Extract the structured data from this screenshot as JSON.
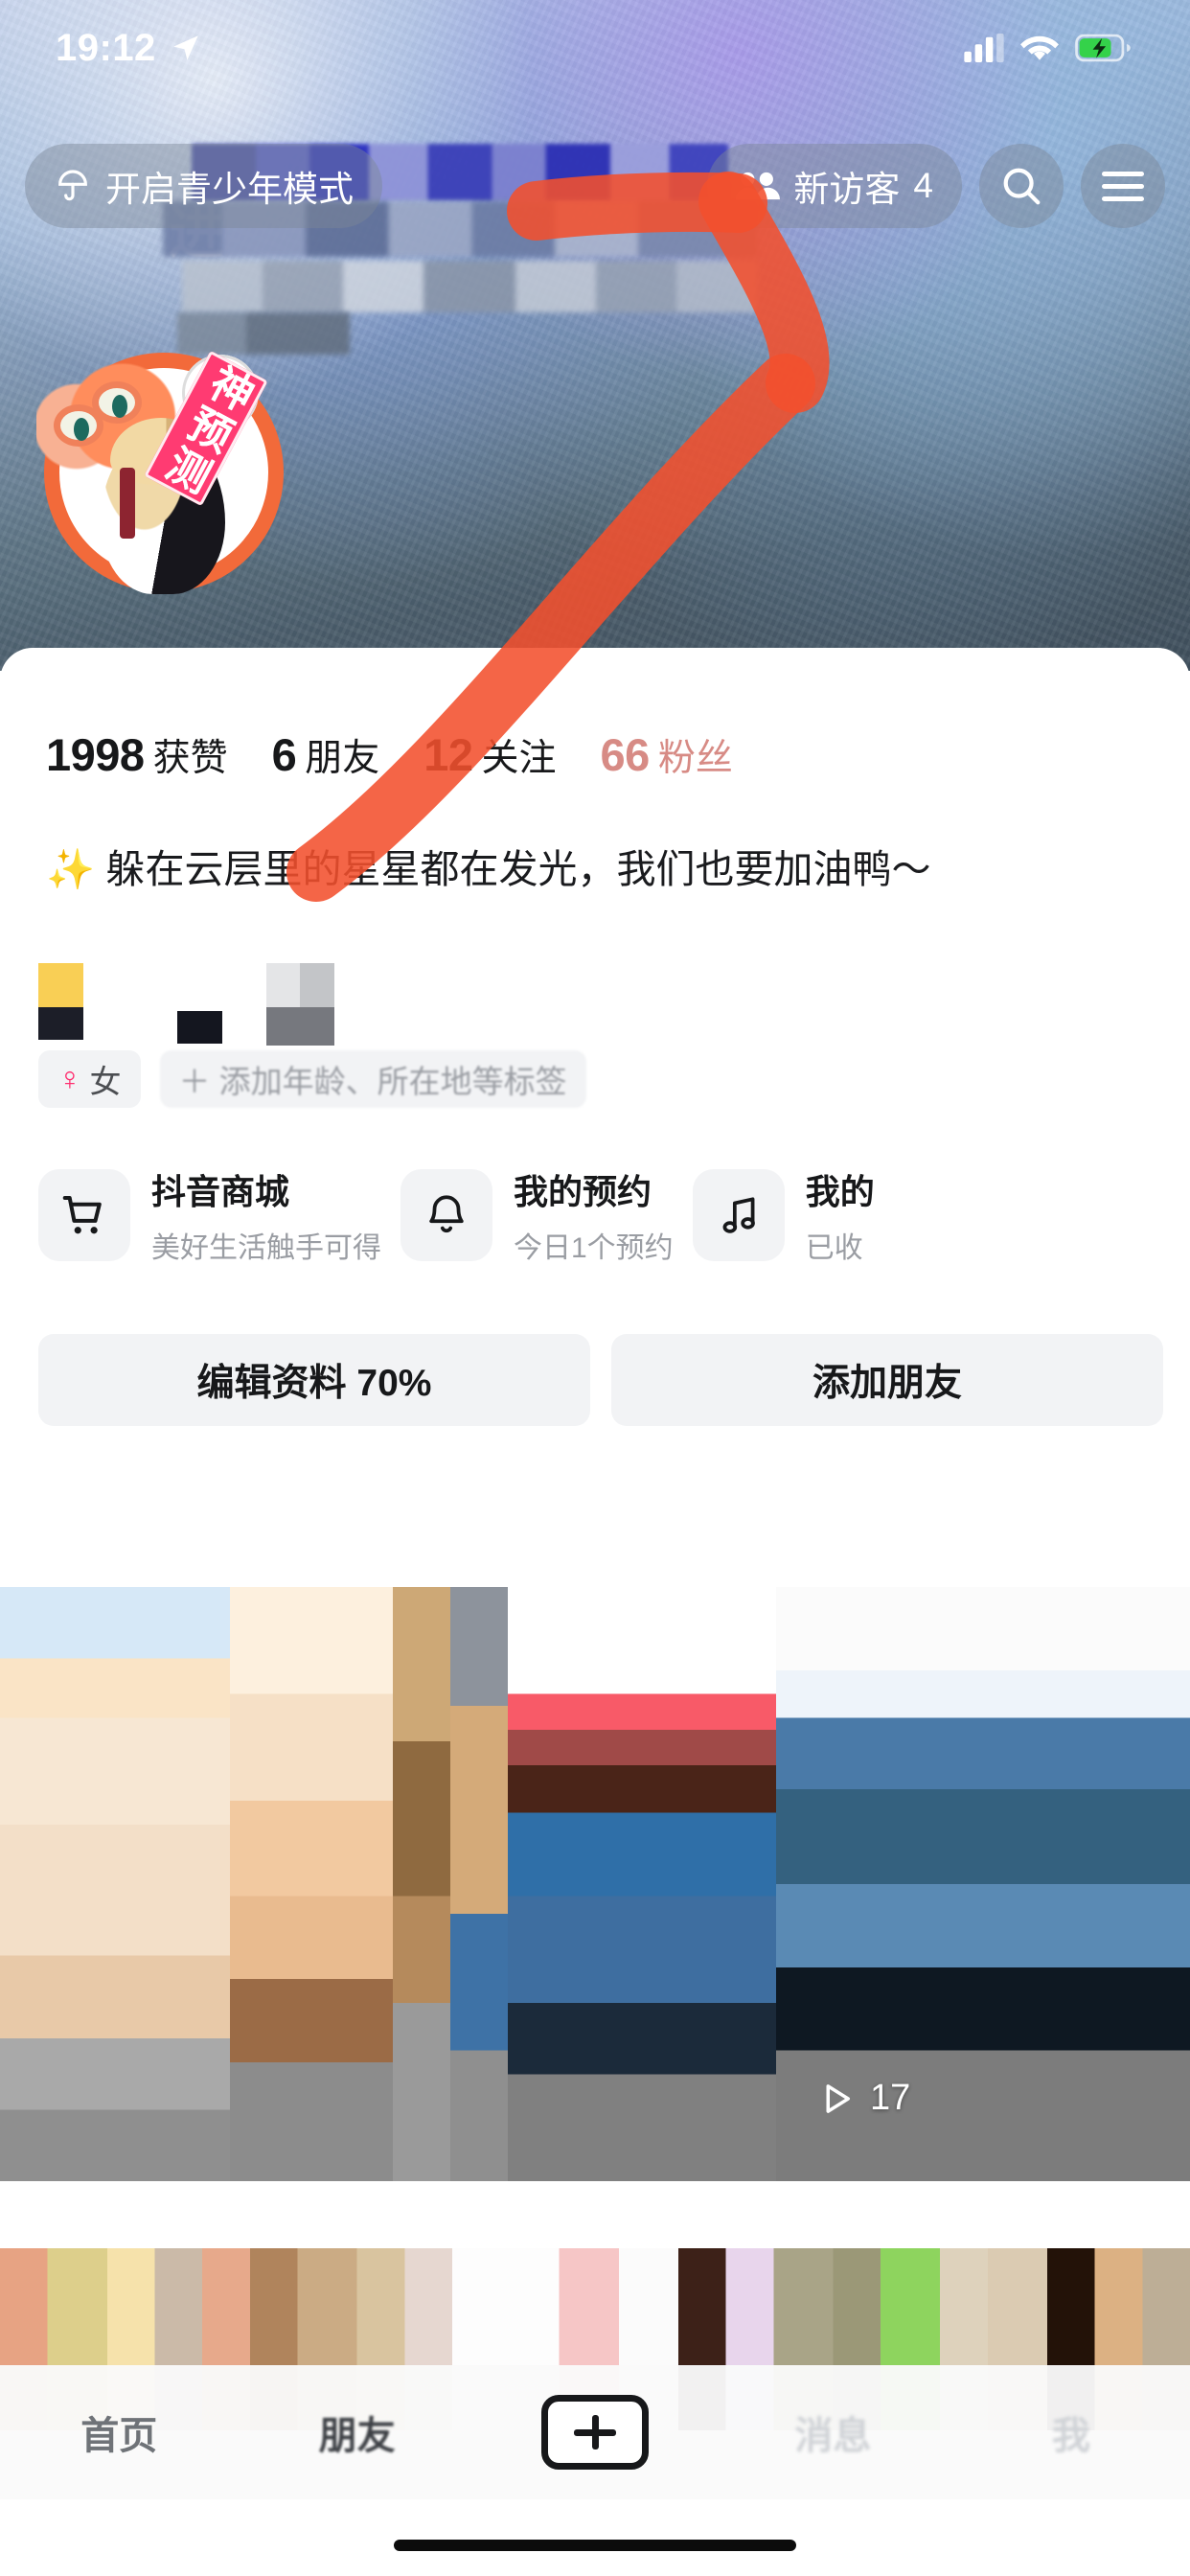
{
  "status_bar": {
    "time": "19:12",
    "location_icon": "location-arrow-icon",
    "signal_icon": "cellular-signal-icon",
    "wifi_icon": "wifi-icon",
    "battery_icon": "battery-charging-icon"
  },
  "header": {
    "teen_mode_label": "开启青少年模式",
    "teen_mode_icon": "umbrella-icon",
    "visitor_label": "新访客",
    "visitor_count": "4",
    "visitor_icon": "visitors-icon",
    "search_icon": "search-icon",
    "menu_icon": "hamburger-menu-icon"
  },
  "avatar": {
    "badge_text": "神预测",
    "sticker_name": "cat-fortune-teller-sticker"
  },
  "stats": [
    {
      "value": "1998",
      "label": "获赞"
    },
    {
      "value": "6",
      "label": "朋友"
    },
    {
      "value": "12",
      "label": "关注"
    },
    {
      "value": "66",
      "label": "粉丝"
    }
  ],
  "bio": {
    "icon": "sparkles-icon",
    "text": "躲在云层里的星星都在发光，我们也要加油鸭～"
  },
  "tags": {
    "gender_symbol": "♀",
    "gender_label": "女",
    "add_label": "＋ 添加年龄、所在地等标签"
  },
  "services": [
    {
      "title": "抖音商城",
      "subtitle": "美好生活触手可得",
      "icon": "shopping-cart-icon"
    },
    {
      "title": "我的预约",
      "subtitle": "今日1个预约",
      "icon": "bell-icon"
    },
    {
      "title": "我的",
      "subtitle": "已收",
      "icon": "music-note-icon"
    }
  ],
  "actions": [
    {
      "label": "编辑资料 70%"
    },
    {
      "label": "添加朋友"
    }
  ],
  "grid": {
    "play_icon": "play-triangle-icon",
    "play_count": "17"
  },
  "bottom_nav": [
    {
      "label": "首页",
      "icon": "home-icon"
    },
    {
      "label": "朋友",
      "icon": "friends-icon"
    },
    {
      "label": "",
      "icon": "plus-create-icon"
    },
    {
      "label": "消息",
      "icon": "message-icon"
    },
    {
      "label": "我",
      "icon": "profile-icon"
    }
  ],
  "colors": {
    "accent_red": "#f2502e",
    "pink": "#ff2d6f",
    "chip_bg": "#f2f3f5",
    "text_primary": "#17181a",
    "text_muted": "#9a9da3"
  }
}
